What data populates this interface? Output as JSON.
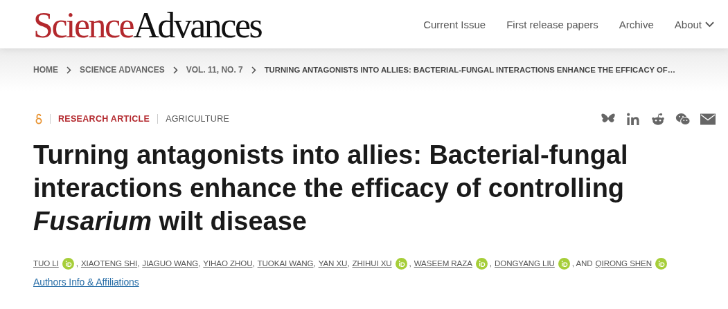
{
  "header": {
    "logo": {
      "part1": "Science",
      "part2": "Advances"
    },
    "nav": [
      {
        "label": "Current Issue",
        "dropdown": false
      },
      {
        "label": "First release papers",
        "dropdown": false
      },
      {
        "label": "Archive",
        "dropdown": false
      },
      {
        "label": "About",
        "dropdown": true
      }
    ]
  },
  "breadcrumb": [
    "HOME",
    "SCIENCE ADVANCES",
    "VOL. 11, NO. 7",
    "TURNING ANTAGONISTS INTO ALLIES: BACTERIAL-FUNGAL INTERACTIONS ENHANCE THE EFFICACY OF…"
  ],
  "article": {
    "open_access": true,
    "type": "RESEARCH ARTICLE",
    "subject": "AGRICULTURE",
    "share": [
      {
        "kind": "bluesky"
      },
      {
        "kind": "linkedin"
      },
      {
        "kind": "reddit"
      },
      {
        "kind": "wechat"
      },
      {
        "kind": "email"
      }
    ],
    "title": "Turning antagonists into allies: Bacterial-fungal interactions enhance the efficacy of controlling *Fusarium* wilt disease",
    "authors": [
      {
        "name": "TUO LI",
        "orcid": true
      },
      {
        "prefix": ",",
        "name": "XIAOTENG SHI",
        "orcid": false
      },
      {
        "prefix": ",",
        "name": "JIAGUO WANG",
        "orcid": false
      },
      {
        "prefix": ",",
        "name": "YIHAO ZHOU",
        "orcid": false
      },
      {
        "prefix": ",",
        "name": "TUOKAI WANG",
        "orcid": false
      },
      {
        "prefix": ",",
        "name": "YAN XU",
        "orcid": false
      },
      {
        "prefix": ",",
        "name": "ZHIHUI XU",
        "orcid": true
      },
      {
        "prefix": ",",
        "name": "WASEEM RAZA",
        "orcid": true
      },
      {
        "prefix": ",",
        "name": "DONGYANG LIU",
        "orcid": true
      },
      {
        "prefix": ", AND",
        "name": "QIRONG SHEN",
        "orcid": true
      }
    ],
    "authors_link": "Authors Info & Affiliations"
  }
}
